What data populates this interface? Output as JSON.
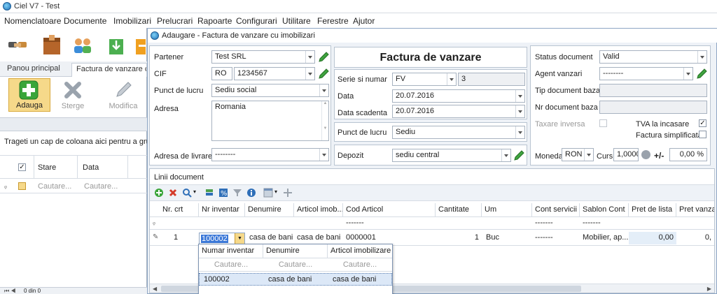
{
  "window_title": "Ciel V7 - Test",
  "menu": [
    "Nomenclatoare",
    "Documente",
    "Imobilizari",
    "Prelucrari",
    "Rapoarte",
    "Configurari",
    "Utilitare",
    "Ferestre",
    "Ajutor"
  ],
  "left": {
    "tabs": [
      "Panou principal",
      "Factura de vanzare c"
    ],
    "buttons": {
      "add": "Adauga",
      "delete": "Sterge",
      "edit": "Modifica"
    },
    "group_hint": "Trageti un cap de coloana aici pentru a grupa",
    "columns": [
      "Stare",
      "Data"
    ],
    "search": [
      "Cautare...",
      "Cautare..."
    ],
    "pager": "0 din 0"
  },
  "dialog": {
    "title": "Adaugare - Factura de vanzare cu imobilizari",
    "partner": {
      "label": "Partener",
      "value": "Test SRL"
    },
    "cif": {
      "label": "CIF",
      "prefix": "RO",
      "value": "1234567"
    },
    "work_point": {
      "label": "Punct de lucru",
      "value": "Sediu social"
    },
    "address": {
      "label": "Adresa",
      "value": "Romania"
    },
    "delivery": {
      "label": "Adresa de livrare",
      "value": "--------"
    },
    "doc_title": "Factura de vanzare",
    "series": {
      "label": "Serie si numar",
      "series": "FV",
      "number": "3"
    },
    "date": {
      "label": "Data",
      "value": "20.07.2016"
    },
    "due_date": {
      "label": "Data scadenta",
      "value": "20.07.2016"
    },
    "work_point2": {
      "label": "Punct de lucru",
      "value": "Sediu"
    },
    "warehouse": {
      "label": "Depozit",
      "value": "sediu central"
    },
    "status": {
      "label": "Status document",
      "value": "Valid"
    },
    "agent": {
      "label": "Agent vanzari",
      "value": "--------"
    },
    "base_type": {
      "label": "Tip document baza",
      "value": ""
    },
    "base_no": {
      "label": "Nr document baza",
      "value": ""
    },
    "reverse_tax": {
      "label": "Taxare inversa"
    },
    "vat_cash": {
      "label": "TVA la incasare",
      "checked": "✓"
    },
    "simplified": {
      "label": "Factura simplificata"
    },
    "currency": {
      "label": "Moneda",
      "value": "RON",
      "rate_label": "Curs",
      "rate": "1,0000",
      "pm": "+/-",
      "pct": "0,00 %"
    },
    "lines_title": "Linii document",
    "columns": [
      "Nr. crt",
      "Nr inventar",
      "Denumire",
      "Articol imob...",
      "Cod Articol",
      "Cantitate",
      "Um",
      "Cont servicii",
      "Sablon Cont",
      "Pret de lista",
      "Pret vanzar"
    ],
    "filter_row": {
      "cod": "-------",
      "cont": "-------",
      "sablon": "-------"
    },
    "row": {
      "nr": "1",
      "inventar": "100002",
      "denumire": "casa de bani",
      "articol": "casa de bani",
      "cod": "0000001",
      "cantitate": "1",
      "um": "Buc",
      "cont": "-------",
      "sablon": "Mobilier, ap...",
      "pret": "0,00",
      "pret2": "0,"
    },
    "popup": {
      "columns": [
        "Numar inventar",
        "Denumire",
        "Articol imobilizare"
      ],
      "search": [
        "Cautare...",
        "Cautare...",
        "Cautare..."
      ],
      "row": [
        "100002",
        "casa de bani",
        "casa de bani"
      ]
    }
  }
}
